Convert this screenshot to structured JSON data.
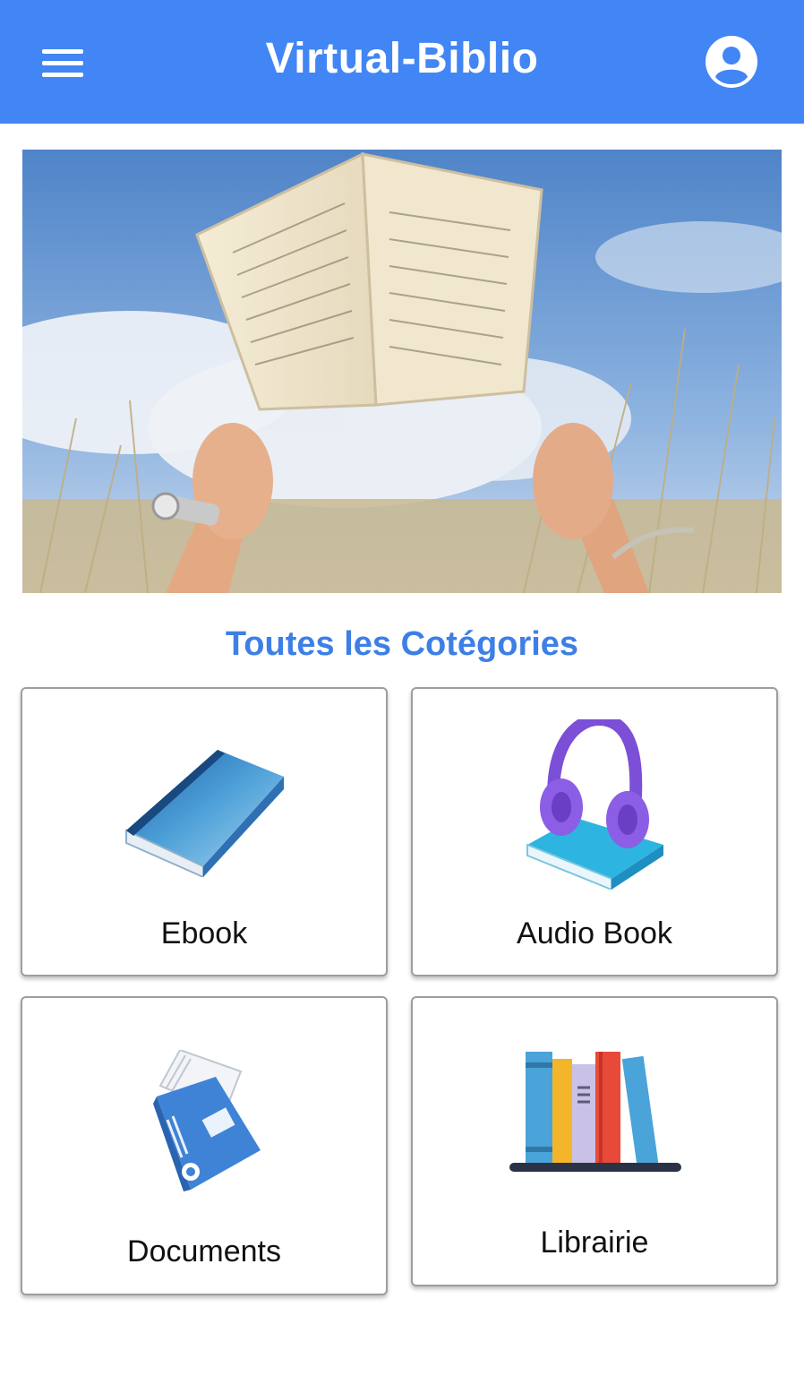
{
  "header": {
    "title": "Virtual-Biblio",
    "menu_icon": "hamburger-menu-icon",
    "account_icon": "account-circle-icon",
    "background": "#4285f4"
  },
  "hero": {
    "image": "hands-holding-open-book-in-field-photo"
  },
  "categories": {
    "title": "Toutes les Cotégories",
    "title_color": "#3d7fe6",
    "items": [
      {
        "label": "Ebook",
        "icon": "ebook-icon"
      },
      {
        "label": "Audio Book",
        "icon": "headphones-on-book-icon"
      },
      {
        "label": "Documents",
        "icon": "binder-book-icon"
      },
      {
        "label": "Librairie",
        "icon": "bookshelf-icon"
      }
    ]
  }
}
